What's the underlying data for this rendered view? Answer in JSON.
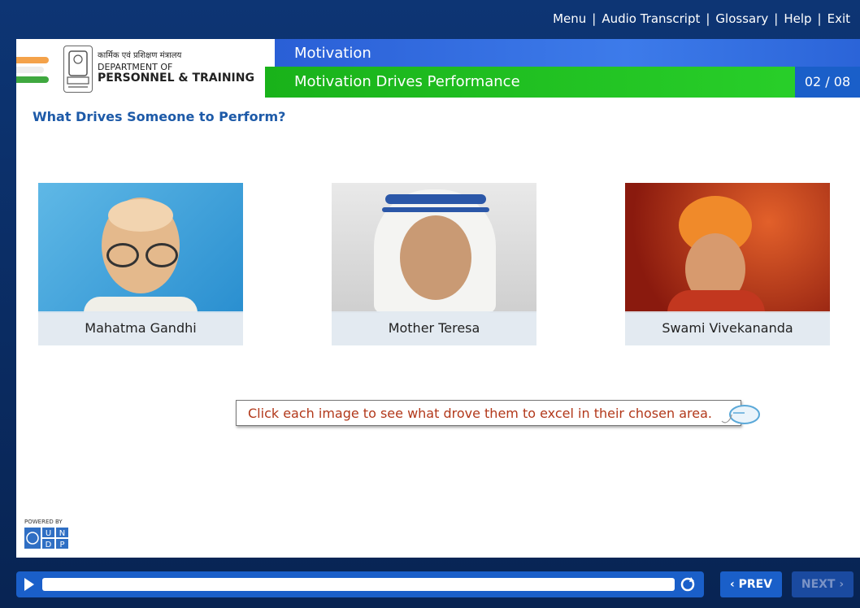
{
  "topmenu": {
    "menu": "Menu",
    "audio": "Audio Transcript",
    "glossary": "Glossary",
    "help": "Help",
    "exit": "Exit",
    "sep": "|"
  },
  "logo": {
    "hindi": "कार्मिक एवं प्रशिक्षण मंत्रालय",
    "line1": "DEPARTMENT OF",
    "line2": "PERSONNEL & TRAINING"
  },
  "header": {
    "module": "Motivation",
    "topic": "Motivation Drives Performance",
    "page": "02 / 08"
  },
  "main": {
    "heading": "What Drives Someone to Perform?",
    "cards": [
      {
        "label": "Mahatma Gandhi"
      },
      {
        "label": "Mother Teresa"
      },
      {
        "label": "Swami Vivekananda"
      }
    ],
    "hint": "Click each image to see what drove them to excel in their chosen area."
  },
  "footer": {
    "powered": "POWERED BY",
    "undp_letters": [
      "U",
      "N",
      "D",
      "P"
    ]
  },
  "controls": {
    "prev": "‹ PREV",
    "next": "NEXT ›"
  },
  "colors": {
    "accent_blue": "#1a5fc9",
    "green_bar": "#19b21a",
    "heading_blue": "#1d5aa8",
    "hint_text": "#b2381a"
  }
}
